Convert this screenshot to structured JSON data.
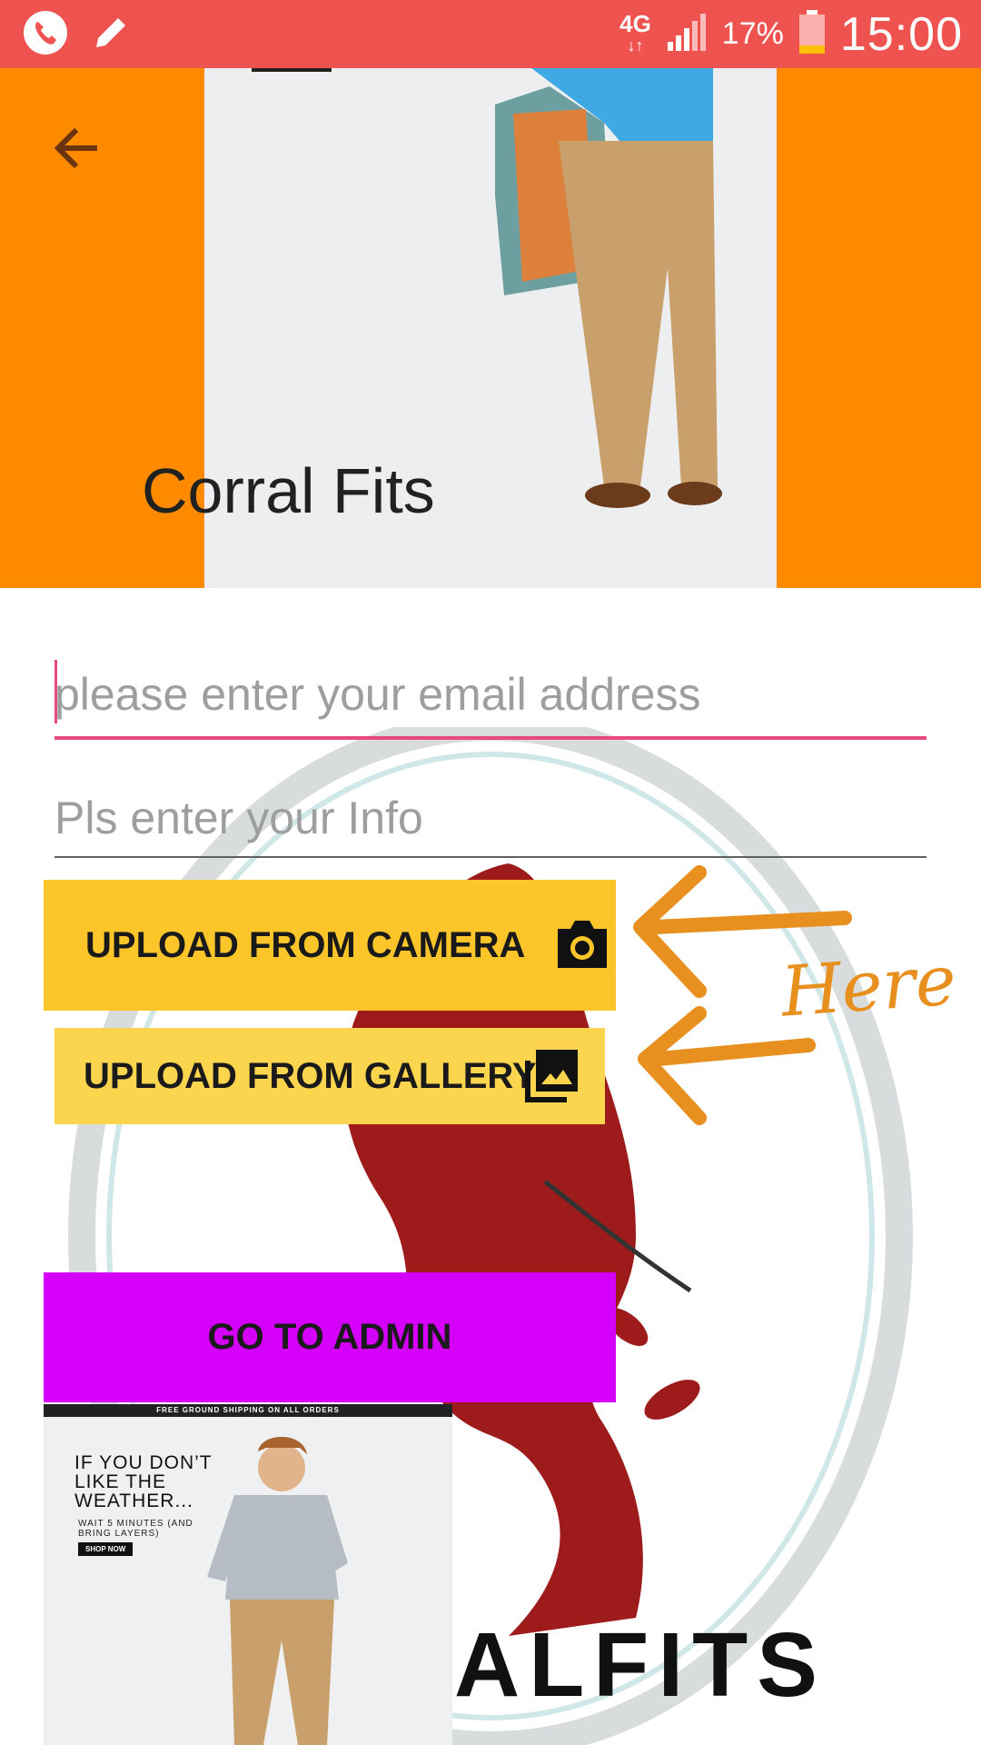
{
  "status_bar": {
    "network": "4G",
    "battery_percent": "17%",
    "time": "15:00",
    "icons": [
      "phone-call-icon",
      "edit-pencil-icon",
      "data-transfer-icon",
      "signal-icon",
      "battery-icon"
    ]
  },
  "header": {
    "title": "Corral Fits",
    "background_color": "#ff8a00",
    "back_icon": "arrow-back-icon"
  },
  "form": {
    "email_placeholder": "please enter your email address",
    "email_value": "",
    "info_placeholder": "Pls enter your Info",
    "info_value": ""
  },
  "buttons": {
    "camera_label": "UPLOAD FROM CAMERA",
    "camera_icon": "camera-icon",
    "gallery_label": "UPLOAD FROM GALLERY",
    "gallery_icon": "photo-library-icon",
    "admin_label": "GO TO ADMIN"
  },
  "annotation": {
    "text": "Here",
    "color": "#e8901f"
  },
  "ad": {
    "top_strip": "FREE GROUND SHIPPING ON ALL ORDERS",
    "headline": "IF YOU DON’T LIKE THE WEATHER...",
    "subtext": "WAIT 5 MINUTES (AND BRING LAYERS)",
    "cta": "SHOP NOW"
  },
  "background_logo": {
    "text": "ALFITS"
  },
  "colors": {
    "status_bar": "#ef5350",
    "accent_pink": "#e74a7d",
    "camera_button": "#fcc62a",
    "gallery_button": "#fcd54f",
    "admin_button": "#d500f9"
  }
}
